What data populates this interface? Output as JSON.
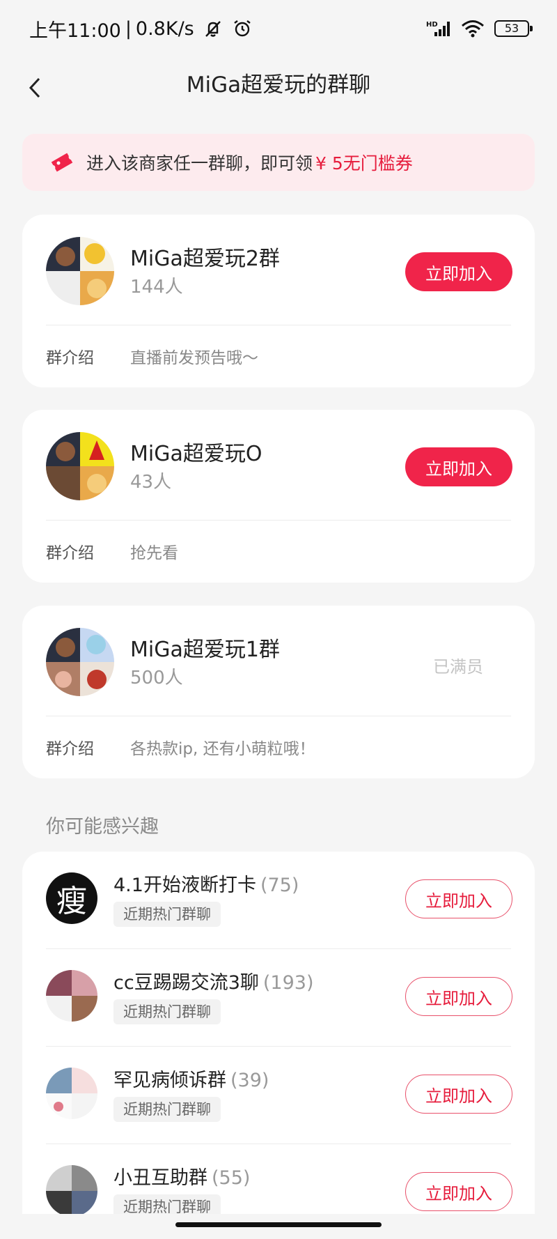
{
  "status_bar": {
    "time": "上午11:00",
    "speed": "0.8K/s",
    "battery": "53",
    "icons": [
      "mute-icon",
      "alarm-icon",
      "hd-signal-icon",
      "wifi-icon",
      "battery-icon"
    ]
  },
  "nav": {
    "title": "MiGa超爱玩的群聊",
    "back_icon": "chevron-left-icon"
  },
  "coupon": {
    "icon": "coupon-ticket-icon",
    "text": "进入该商家任一群聊，即可领",
    "highlight": "¥ 5无门槛券"
  },
  "colors": {
    "accent": "#f0244a",
    "banner_bg": "#fdebee",
    "page_bg": "#f5f5f5"
  },
  "groups": [
    {
      "name": "MiGa超爱玩2群",
      "count": "144人",
      "action": "立即加入",
      "intro_label": "群介绍",
      "intro": "直播前发预告哦～"
    },
    {
      "name": "MiGa超爱玩O",
      "count": "43人",
      "action": "立即加入",
      "intro_label": "群介绍",
      "intro": "抢先看"
    },
    {
      "name": "MiGa超爱玩1群",
      "count": "500人",
      "action": "已满员",
      "intro_label": "群介绍",
      "intro": "各热款ip, 还有小萌粒哦！"
    }
  ],
  "recommend": {
    "title": "你可能感兴趣",
    "items": [
      {
        "name": "4.1开始液断打卡",
        "count": "(75)",
        "tag": "近期热门群聊",
        "action": "立即加入",
        "avatar_char": "瘦"
      },
      {
        "name": "cc豆踢踢交流3聊",
        "count": "(193)",
        "tag": "近期热门群聊",
        "action": "立即加入"
      },
      {
        "name": "罕见病倾诉群",
        "count": "(39)",
        "tag": "近期热门群聊",
        "action": "立即加入"
      },
      {
        "name": "小丑互助群",
        "count": "(55)",
        "tag": "近期热门群聊",
        "action": "立即加入"
      }
    ]
  }
}
